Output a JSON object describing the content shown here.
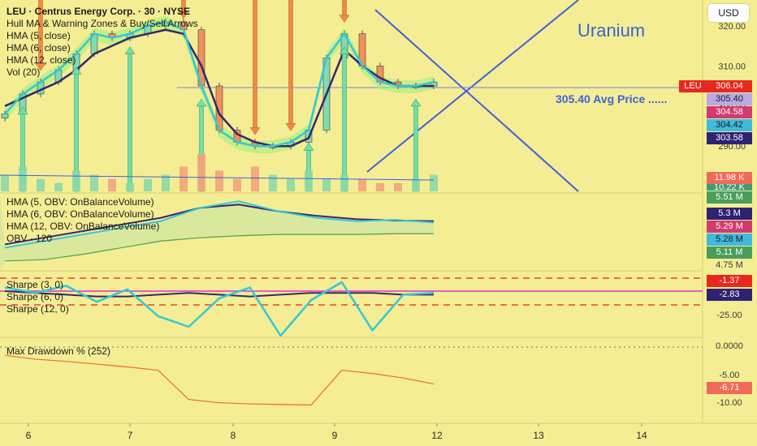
{
  "header": {
    "title": "LEU · Centrus Energy Corp. · 30 · NYSE",
    "indicators": [
      "Hull MA & Warning Zones & Buy/Sell Arrows",
      "HMA (5, close)",
      "HMA (6, close)",
      "HMA (12, close)",
      "Vol (20)"
    ],
    "currency_button": "USD"
  },
  "annotations": {
    "uranium": "Uranium",
    "avg_price": "305.40 Avg Price ......"
  },
  "obv_pane": {
    "legend": [
      "HMA (5, OBV: OnBalanceVolume)",
      "HMA (6, OBV: OnBalanceVolume)",
      "HMA (12, OBV: OnBalanceVolume)",
      "OBV · 120"
    ]
  },
  "sharpe_pane": {
    "legend": [
      "Sharpe (3, 0)",
      "Sharpe (6, 0)",
      "Sharpe (12, 0)"
    ]
  },
  "drawdown_pane": {
    "legend": [
      "Max Drawdown % (252)"
    ]
  },
  "colors": {
    "background": "#f4ed94",
    "hma5": "#35c6d8",
    "hma12": "#38266e",
    "bull": "#7fdcb0",
    "bear": "#f0915a",
    "arrow_up": "#6ee0a8",
    "arrow_down": "#f08a45",
    "trendline": "#3d63d6",
    "drawdown": "#f06a2e",
    "sharpe_zero": "#e22fd0",
    "sharpe_band": "#e3452e"
  },
  "chart_data": [
    {
      "type": "candlestick",
      "title": "LEU · Centrus Energy Corp. · 30 · NYSE",
      "x": [
        "6",
        "7",
        "8",
        "9",
        "12",
        "13",
        "14"
      ],
      "x_tick_labels": [
        "6",
        "7",
        "8",
        "9",
        "12",
        "13",
        "14"
      ],
      "y_ticks": [
        290,
        300,
        310,
        320
      ],
      "y_tick_labels": [
        "290.00",
        "300.00",
        "310.00",
        "320.00"
      ],
      "ylim": [
        286,
        324
      ],
      "price_labels": [
        {
          "label": "LEU",
          "value": 306.04,
          "color": "#e8271e"
        },
        {
          "value": 305.4,
          "color": "#b9a7e6"
        },
        {
          "value": 304.58,
          "color": "#d13b6f"
        },
        {
          "value": 304.42,
          "color": "#3fb9dc"
        },
        {
          "value": 303.58,
          "color": "#2d2372"
        }
      ],
      "price_label_texts": [
        "306.04",
        "305.40",
        "304.58",
        "304.42",
        "303.58"
      ],
      "avg_price_line": 305.4,
      "series": [
        {
          "name": "HMA (5, close)",
          "values": [
            298,
            303,
            306,
            309,
            313,
            318,
            317,
            318,
            320,
            321,
            319,
            305,
            294,
            291,
            290,
            290,
            291,
            294,
            312,
            318,
            310,
            306,
            305,
            305,
            306
          ]
        },
        {
          "name": "HMA (12, close)",
          "values": [
            300,
            302,
            304,
            306,
            309,
            313,
            315,
            317,
            318,
            319,
            318,
            310,
            298,
            293,
            291,
            290,
            290,
            292,
            303,
            314,
            310,
            307,
            305,
            305,
            305
          ]
        }
      ],
      "arrows_up_x": [
        1,
        4,
        7,
        11,
        17,
        19,
        23
      ],
      "arrows_down_x": [
        2,
        10,
        14,
        16,
        19
      ]
    },
    {
      "type": "bar",
      "title": "Vol (20)",
      "value_labels": [
        "11.98 K",
        "10.22 K"
      ],
      "values": [
        4,
        6,
        3,
        2,
        5,
        4,
        3,
        2,
        3,
        4,
        6,
        9,
        5,
        3,
        6,
        4,
        3,
        5,
        3,
        4,
        3,
        2,
        2,
        3,
        4
      ]
    },
    {
      "type": "line",
      "title": "OBV",
      "value_labels": [
        "5.51 M",
        "5.3 M",
        "5.29 M",
        "5.28 M",
        "5.11 M",
        "4.75 M"
      ],
      "series": [
        {
          "name": "HMA (5, OBV: OnBalanceVolume)",
          "values": [
            4.9,
            5.0,
            5.1,
            5.2,
            5.3,
            5.5,
            5.6,
            5.45,
            5.35,
            5.3,
            5.32,
            5.28
          ]
        },
        {
          "name": "HMA (12, OBV: OnBalanceVolume)",
          "values": [
            4.95,
            5.05,
            5.15,
            5.25,
            5.35,
            5.5,
            5.55,
            5.45,
            5.38,
            5.33,
            5.31,
            5.3
          ]
        },
        {
          "name": "OBV · 120",
          "values": [
            4.7,
            4.72,
            4.8,
            4.9,
            5.0,
            5.05,
            5.08,
            5.1,
            5.1,
            5.1,
            5.11,
            5.11
          ]
        }
      ]
    },
    {
      "type": "line",
      "title": "Sharpe",
      "value_labels": [
        "-1.37",
        "-2.83",
        "-25.00"
      ],
      "series": [
        {
          "name": "Sharpe (3, 0)",
          "values": [
            2,
            -1,
            3,
            -6,
            1,
            -14,
            -20,
            -4,
            2,
            -25,
            -5,
            5,
            -22,
            -2,
            -1
          ]
        },
        {
          "name": "Sharpe (12, 0)",
          "values": [
            0,
            -1,
            -2,
            -3,
            -3,
            -2,
            -1,
            -2,
            -3,
            -2,
            -1,
            -1,
            -1,
            -2,
            -2
          ]
        }
      ]
    },
    {
      "type": "line",
      "title": "Max Drawdown % (252)",
      "y_tick_labels": [
        "0.0000",
        "-5.00",
        "-10.00"
      ],
      "value_labels": [
        "-6.71"
      ],
      "series": [
        {
          "name": "Max Drawdown % (252)",
          "values": [
            -1.5,
            -2.2,
            -2.6,
            -3.1,
            -3.6,
            -4.2,
            -9.5,
            -10.1,
            -10.3,
            -10.4,
            -10.5,
            -4.2,
            -4.8,
            -5.6,
            -6.7
          ]
        }
      ]
    }
  ]
}
